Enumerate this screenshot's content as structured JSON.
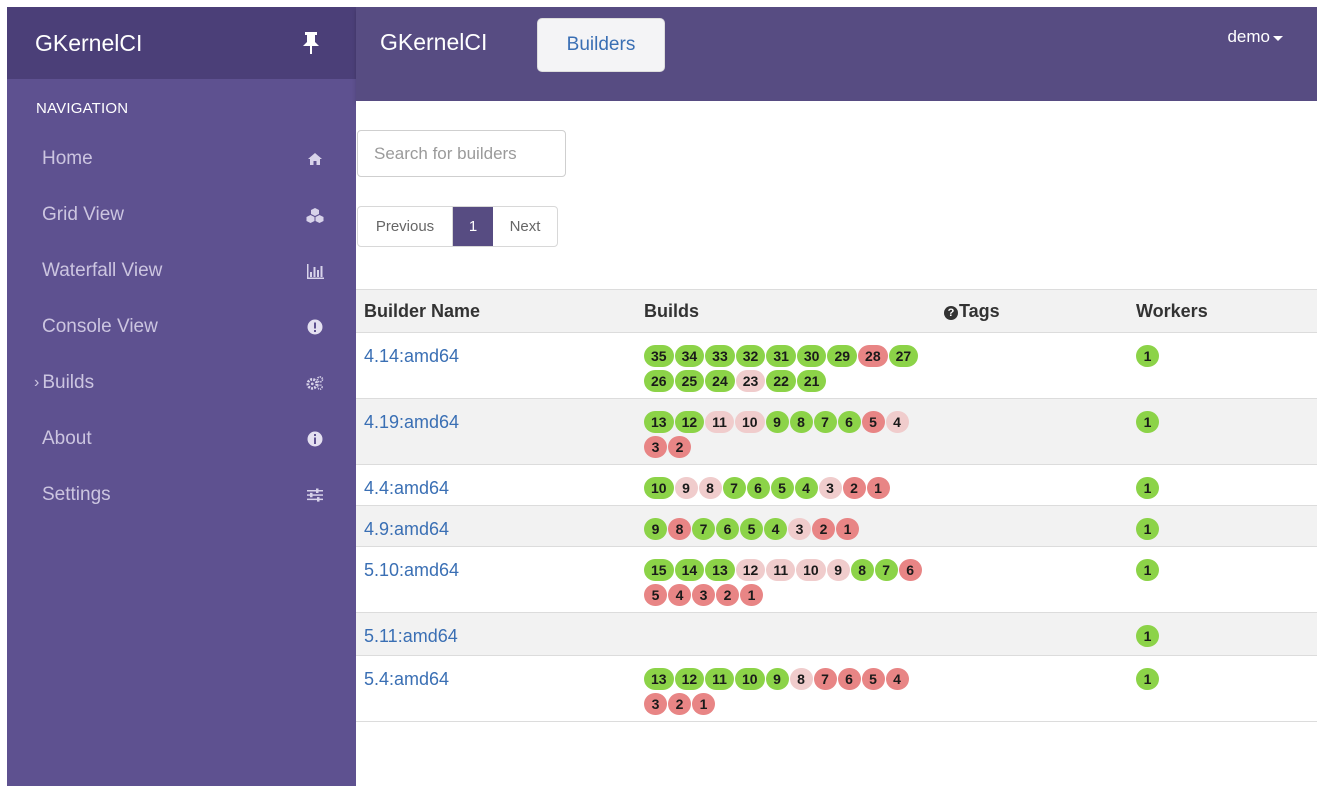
{
  "sidebar": {
    "brand": "GKernelCI",
    "nav_heading": "NAVIGATION",
    "items": [
      {
        "label": "Home",
        "icon": "home-icon"
      },
      {
        "label": "Grid View",
        "icon": "cubes-icon"
      },
      {
        "label": "Waterfall View",
        "icon": "bar-chart-icon"
      },
      {
        "label": "Console View",
        "icon": "exclamation-circle-icon"
      },
      {
        "label": "Builds",
        "icon": "cogs-icon",
        "caret": "›"
      },
      {
        "label": "About",
        "icon": "info-circle-icon"
      },
      {
        "label": "Settings",
        "icon": "sliders-icon"
      }
    ]
  },
  "topbar": {
    "brand": "GKernelCI",
    "breadcrumb": "Builders",
    "user": "demo"
  },
  "search": {
    "placeholder": "Search for builders"
  },
  "pager": {
    "previous": "Previous",
    "current": "1",
    "next": "Next"
  },
  "table": {
    "headers": {
      "name": "Builder Name",
      "builds": "Builds",
      "tags": "Tags",
      "workers": "Workers"
    },
    "rows": [
      {
        "name": "4.14:amd64",
        "workers": "1",
        "builds": [
          {
            "n": "35",
            "s": "success"
          },
          {
            "n": "34",
            "s": "success"
          },
          {
            "n": "33",
            "s": "success"
          },
          {
            "n": "32",
            "s": "success"
          },
          {
            "n": "31",
            "s": "success"
          },
          {
            "n": "30",
            "s": "success"
          },
          {
            "n": "29",
            "s": "success"
          },
          {
            "n": "28",
            "s": "failure"
          },
          {
            "n": "27",
            "s": "success"
          },
          {
            "n": "26",
            "s": "success"
          },
          {
            "n": "25",
            "s": "success"
          },
          {
            "n": "24",
            "s": "success"
          },
          {
            "n": "23",
            "s": "warning"
          },
          {
            "n": "22",
            "s": "success"
          },
          {
            "n": "21",
            "s": "success"
          }
        ]
      },
      {
        "name": "4.19:amd64",
        "workers": "1",
        "builds": [
          {
            "n": "13",
            "s": "success"
          },
          {
            "n": "12",
            "s": "success"
          },
          {
            "n": "11",
            "s": "warning"
          },
          {
            "n": "10",
            "s": "warning"
          },
          {
            "n": "9",
            "s": "success"
          },
          {
            "n": "8",
            "s": "success"
          },
          {
            "n": "7",
            "s": "success"
          },
          {
            "n": "6",
            "s": "success"
          },
          {
            "n": "5",
            "s": "failure"
          },
          {
            "n": "4",
            "s": "warning"
          },
          {
            "n": "3",
            "s": "failure"
          },
          {
            "n": "2",
            "s": "failure"
          }
        ]
      },
      {
        "name": "4.4:amd64",
        "workers": "1",
        "builds": [
          {
            "n": "10",
            "s": "success"
          },
          {
            "n": "9",
            "s": "warning"
          },
          {
            "n": "8",
            "s": "warning"
          },
          {
            "n": "7",
            "s": "success"
          },
          {
            "n": "6",
            "s": "success"
          },
          {
            "n": "5",
            "s": "success"
          },
          {
            "n": "4",
            "s": "success"
          },
          {
            "n": "3",
            "s": "warning"
          },
          {
            "n": "2",
            "s": "failure"
          },
          {
            "n": "1",
            "s": "failure"
          }
        ]
      },
      {
        "name": "4.9:amd64",
        "workers": "1",
        "builds": [
          {
            "n": "9",
            "s": "success"
          },
          {
            "n": "8",
            "s": "failure"
          },
          {
            "n": "7",
            "s": "success"
          },
          {
            "n": "6",
            "s": "success"
          },
          {
            "n": "5",
            "s": "success"
          },
          {
            "n": "4",
            "s": "success"
          },
          {
            "n": "3",
            "s": "warning"
          },
          {
            "n": "2",
            "s": "failure"
          },
          {
            "n": "1",
            "s": "failure"
          }
        ]
      },
      {
        "name": "5.10:amd64",
        "workers": "1",
        "builds": [
          {
            "n": "15",
            "s": "success"
          },
          {
            "n": "14",
            "s": "success"
          },
          {
            "n": "13",
            "s": "success"
          },
          {
            "n": "12",
            "s": "warning"
          },
          {
            "n": "11",
            "s": "warning"
          },
          {
            "n": "10",
            "s": "warning"
          },
          {
            "n": "9",
            "s": "warning"
          },
          {
            "n": "8",
            "s": "success"
          },
          {
            "n": "7",
            "s": "success"
          },
          {
            "n": "6",
            "s": "failure"
          },
          {
            "n": "5",
            "s": "failure"
          },
          {
            "n": "4",
            "s": "failure"
          },
          {
            "n": "3",
            "s": "failure"
          },
          {
            "n": "2",
            "s": "failure"
          },
          {
            "n": "1",
            "s": "failure"
          }
        ]
      },
      {
        "name": "5.11:amd64",
        "workers": "1",
        "builds": []
      },
      {
        "name": "5.4:amd64",
        "workers": "1",
        "builds": [
          {
            "n": "13",
            "s": "success"
          },
          {
            "n": "12",
            "s": "success"
          },
          {
            "n": "11",
            "s": "success"
          },
          {
            "n": "10",
            "s": "success"
          },
          {
            "n": "9",
            "s": "success"
          },
          {
            "n": "8",
            "s": "warning"
          },
          {
            "n": "7",
            "s": "failure"
          },
          {
            "n": "6",
            "s": "failure"
          },
          {
            "n": "5",
            "s": "failure"
          },
          {
            "n": "4",
            "s": "failure"
          },
          {
            "n": "3",
            "s": "failure"
          },
          {
            "n": "2",
            "s": "failure"
          },
          {
            "n": "1",
            "s": "failure"
          }
        ]
      }
    ]
  },
  "colors": {
    "sidebar_bg": "#5e5190",
    "topbar_bg": "#574c82",
    "success": "#8cd348",
    "failure": "#e88585",
    "warning": "#f0cccc",
    "link": "#3a6fb4"
  }
}
